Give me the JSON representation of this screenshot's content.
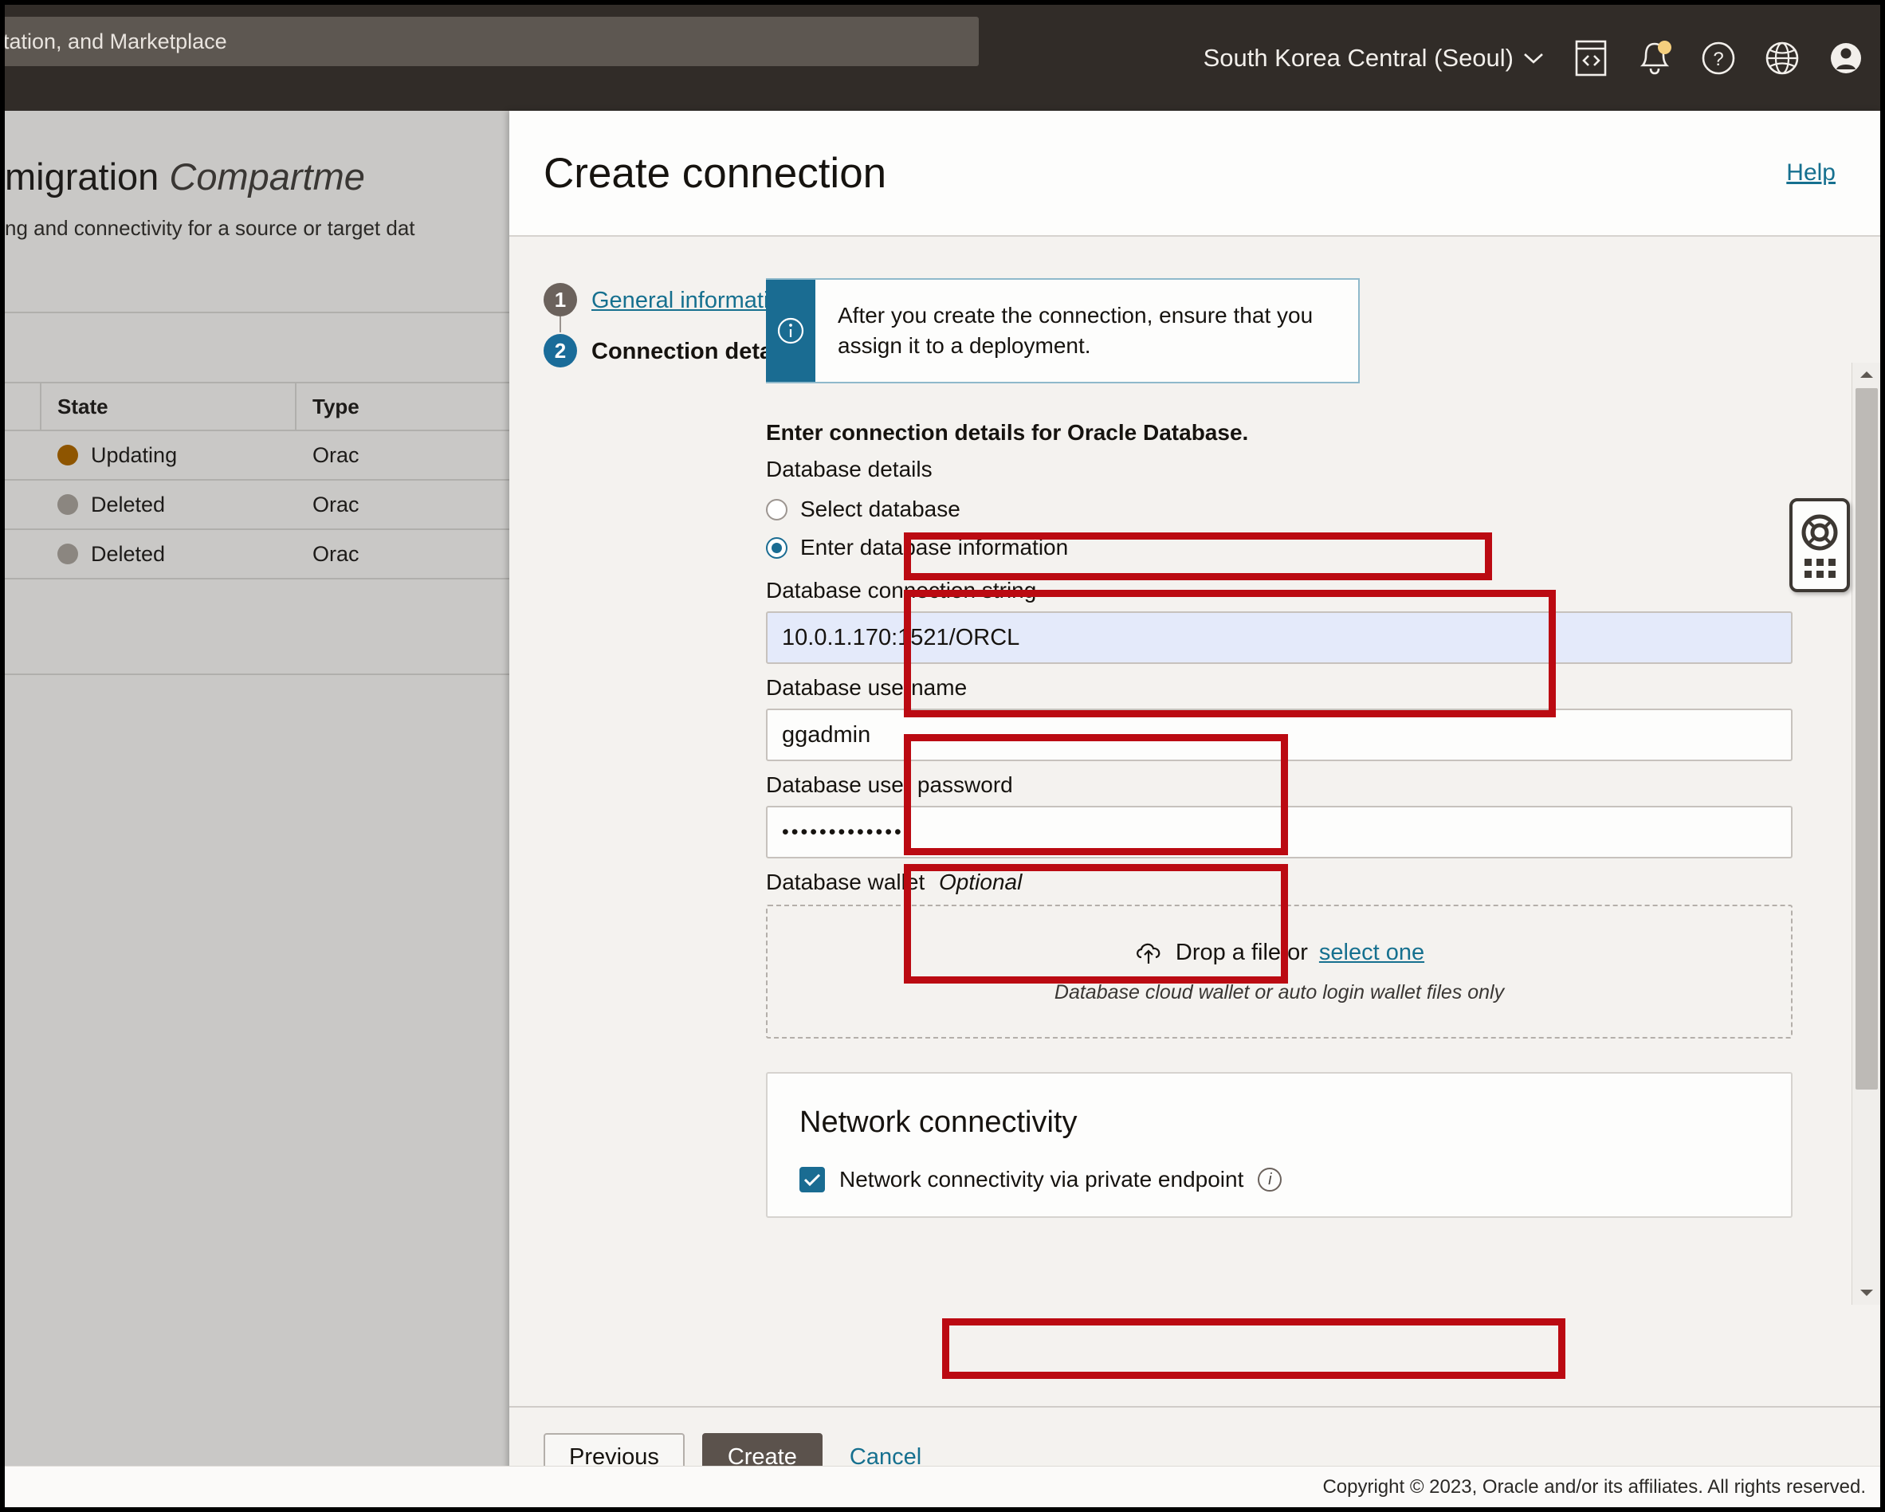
{
  "header": {
    "search_placeholder": "tation, and Marketplace",
    "region": "South Korea Central (Seoul)",
    "region_chevron": "⌄",
    "icons": {
      "cloud_shell": "cloud-shell-icon",
      "notifications": "bell-icon",
      "help": "help-circle-icon",
      "language": "globe-icon",
      "profile": "user-avatar-icon"
    }
  },
  "background_page": {
    "title_plain": "migration",
    "title_italic": "Compartme",
    "subtitle": "ng and connectivity for a source or target dat",
    "table": {
      "columns": [
        "State",
        "Type"
      ],
      "rows": [
        {
          "state": "Updating",
          "state_color": "#8e5500",
          "type": "Orac"
        },
        {
          "state": "Deleted",
          "state_color": "#8b8680",
          "type": "Orac"
        },
        {
          "state": "Deleted",
          "state_color": "#8b8680",
          "type": "Orac"
        }
      ]
    }
  },
  "panel": {
    "title": "Create connection",
    "help_label": "Help",
    "steps": [
      {
        "number": "1",
        "label": "General information",
        "state": "completed"
      },
      {
        "number": "2",
        "label": "Connection details",
        "state": "current"
      }
    ],
    "info_banner": {
      "icon": "info-circle-icon",
      "text": "After you create the connection, ensure that you assign it to a deployment."
    },
    "form": {
      "heading": "Enter connection details for Oracle Database.",
      "database_details_label": "Database details",
      "radio_options": [
        {
          "label": "Select database",
          "selected": false
        },
        {
          "label": "Enter database information",
          "selected": true
        }
      ],
      "connection_string": {
        "label": "Database connection string",
        "value": "10.0.1.170:1521/ORCL"
      },
      "username": {
        "label": "Database username",
        "value": "ggadmin"
      },
      "password": {
        "label": "Database user password",
        "value": "•••••••••••••"
      },
      "wallet": {
        "label": "Database wallet",
        "optional_tag": "Optional",
        "dropzone_icon": "cloud-upload-icon",
        "dropzone_text": "Drop a file or",
        "dropzone_link": "select one",
        "dropzone_hint": "Database cloud wallet or auto login wallet files only"
      },
      "network": {
        "card_title": "Network connectivity",
        "checkbox_label": "Network connectivity via private endpoint",
        "checkbox_checked": true,
        "info_icon": "info-circle-small-icon"
      }
    },
    "footer": {
      "previous_label": "Previous",
      "create_label": "Create",
      "cancel_label": "Cancel"
    }
  },
  "float_widget": {
    "help_icon": "life-ring-icon",
    "drag_handle_icon": "grid-dots-icon"
  },
  "copyright": "Copyright © 2023, Oracle and/or its affiliates. All rights reserved.",
  "colors": {
    "accent_blue": "#1a6c92",
    "link_blue": "#16708f",
    "annotation_red": "#bb0a12",
    "create_button": "#5b524c",
    "autofill_blue": "#e4eafa"
  }
}
